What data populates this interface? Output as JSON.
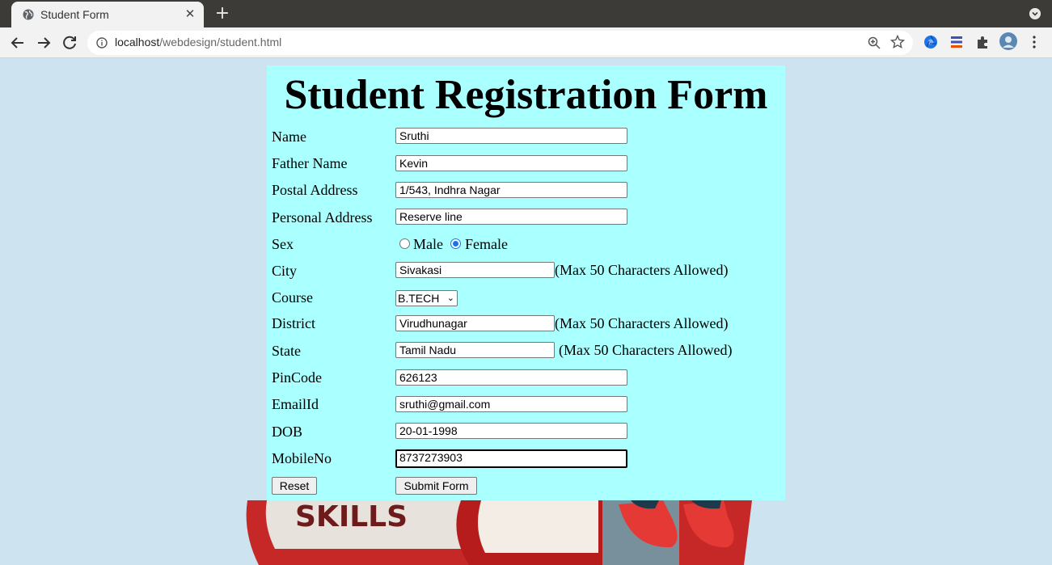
{
  "browser": {
    "tab_title": "Student Form",
    "url_host": "localhost",
    "url_path": "/webdesign/student.html"
  },
  "form": {
    "heading": "Student Registration Form",
    "name": {
      "label": "Name",
      "value": "Sruthi"
    },
    "father_name": {
      "label": "Father Name",
      "value": "Kevin"
    },
    "postal_address": {
      "label": "Postal Address",
      "value": "1/543, Indhra Nagar"
    },
    "personal_address": {
      "label": "Personal Address",
      "value": "Reserve line"
    },
    "sex": {
      "label": "Sex",
      "options": [
        "Male",
        "Female"
      ],
      "selected": "Female"
    },
    "city": {
      "label": "City",
      "value": "Sivakasi",
      "note": "(Max 50 Characters Allowed)"
    },
    "course": {
      "label": "Course",
      "selected": "B.TECH"
    },
    "district": {
      "label": "District",
      "value": "Virudhunagar",
      "note": "(Max 50 Characters Allowed)"
    },
    "state": {
      "label": "State",
      "value": "Tamil Nadu",
      "note": "(Max 50 Characters Allowed)"
    },
    "pincode": {
      "label": "PinCode",
      "value": "626123"
    },
    "email": {
      "label": "EmailId",
      "value": "sruthi@gmail.com"
    },
    "dob": {
      "label": "DOB",
      "value": "20-01-1998"
    },
    "mobile": {
      "label": "MobileNo",
      "value": "8737273903"
    },
    "reset_label": "Reset",
    "submit_label": "Submit Form"
  },
  "background": {
    "skills_text": "SKILLS"
  }
}
